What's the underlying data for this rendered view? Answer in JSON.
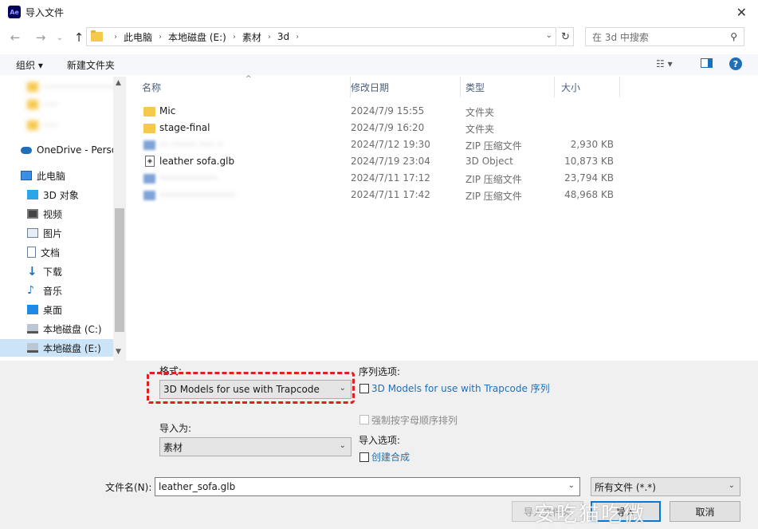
{
  "window": {
    "title": "导入文件",
    "app_icon": "Ae"
  },
  "nav": {
    "breadcrumbs": [
      "此电脑",
      "本地磁盘 (E:)",
      "素材",
      "3d"
    ],
    "search_placeholder": "在 3d 中搜索"
  },
  "toolbar": {
    "organize": "组织 ▾",
    "new_folder": "新建文件夹"
  },
  "sidebar": {
    "blurred_items": [
      "···························",
      "·····",
      "·····"
    ],
    "onedrive": "OneDrive - Perso",
    "this_pc": "此电脑",
    "items": [
      "3D 对象",
      "视频",
      "图片",
      "文档",
      "下载",
      "音乐",
      "桌面",
      "本地磁盘 (C:)",
      "本地磁盘 (E:)"
    ]
  },
  "columns": {
    "name": "名称",
    "date": "修改日期",
    "type": "类型",
    "size": "大小"
  },
  "files": [
    {
      "name": "Mic",
      "date": "2024/7/9 15:55",
      "type": "文件夹",
      "size": "",
      "kind": "folder"
    },
    {
      "name": "stage-final",
      "date": "2024/7/9 16:20",
      "type": "文件夹",
      "size": "",
      "kind": "folder"
    },
    {
      "name": "··· ········ ····· ··",
      "date": "2024/7/12 19:30",
      "type": "ZIP 压缩文件",
      "size": "2,930 KB",
      "kind": "zip-blurred"
    },
    {
      "name": "leather sofa.glb",
      "date": "2024/7/19 23:04",
      "type": "3D Object",
      "size": "10,873 KB",
      "kind": "glb"
    },
    {
      "name": "···················",
      "date": "2024/7/11 17:12",
      "type": "ZIP 压缩文件",
      "size": "23,794 KB",
      "kind": "zip-blurred"
    },
    {
      "name": "·························",
      "date": "2024/7/11 17:42",
      "type": "ZIP 压缩文件",
      "size": "48,968 KB",
      "kind": "zip-blurred"
    }
  ],
  "options": {
    "format_label": "格式:",
    "format_value": "3D Models for use with Trapcode",
    "import_as_label": "导入为:",
    "import_as_value": "素材",
    "sequence_label": "序列选项:",
    "sequence_checkbox": "3D Models for use with Trapcode 序列",
    "alpha_sort": "强制按字母顺序排列",
    "import_options_label": "导入选项:",
    "create_comp": "创建合成"
  },
  "filename": {
    "label": "文件名(N):",
    "value": "leather_sofa.glb",
    "filter": "所有文件 (*.*)"
  },
  "buttons": {
    "import_folder": "导入文件夹",
    "import": "导入",
    "cancel": "取消"
  },
  "watermark": "安吃猫吃微"
}
